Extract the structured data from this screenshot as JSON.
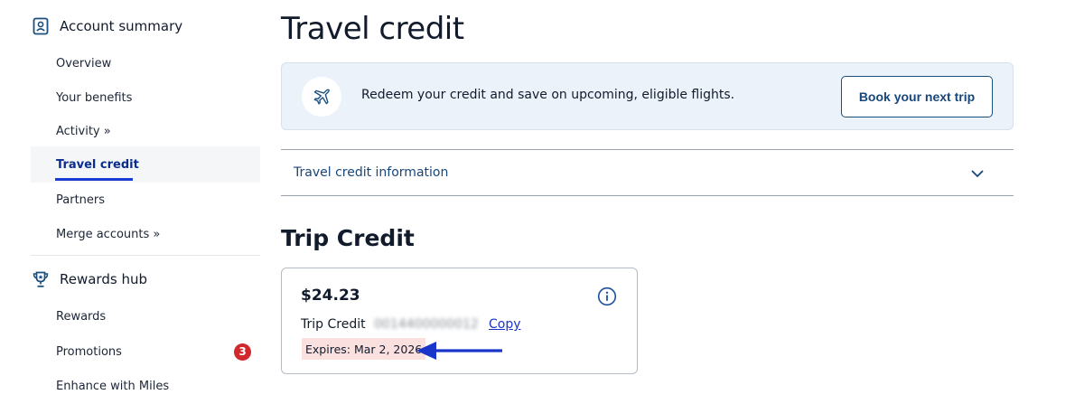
{
  "sidebar": {
    "account_summary": {
      "heading": "Account summary",
      "icon": "account-card-icon",
      "items": [
        {
          "label": "Overview"
        },
        {
          "label": "Your benefits"
        },
        {
          "label": "Activity »"
        },
        {
          "label": "Travel credit"
        },
        {
          "label": "Partners"
        },
        {
          "label": "Merge accounts »"
        }
      ]
    },
    "rewards_hub": {
      "heading": "Rewards hub",
      "icon": "trophy-icon",
      "items": [
        {
          "label": "Rewards"
        },
        {
          "label": "Promotions",
          "badge": "3"
        },
        {
          "label": "Enhance with Miles"
        }
      ]
    }
  },
  "main": {
    "title": "Travel credit",
    "banner": {
      "icon": "airplane-icon",
      "text": "Redeem your credit and save on upcoming, eligible flights.",
      "button_label": "Book your next trip"
    },
    "accordion": {
      "label": "Travel credit information",
      "icon": "chevron-down-icon"
    },
    "section_title": "Trip Credit",
    "credit_card": {
      "amount": "$24.23",
      "label": "Trip Credit",
      "number": "0014400000012",
      "copy_label": "Copy",
      "expires": "Expires: Mar 2, 2026"
    }
  },
  "colors": {
    "accent_blue": "#1a3bd4",
    "button_navy": "#17477a",
    "banner_bg": "#ecf2fa",
    "badge_red": "#d0282d",
    "expires_highlight": "#fbe0e0",
    "annotation_arrow": "#1a35c9"
  }
}
